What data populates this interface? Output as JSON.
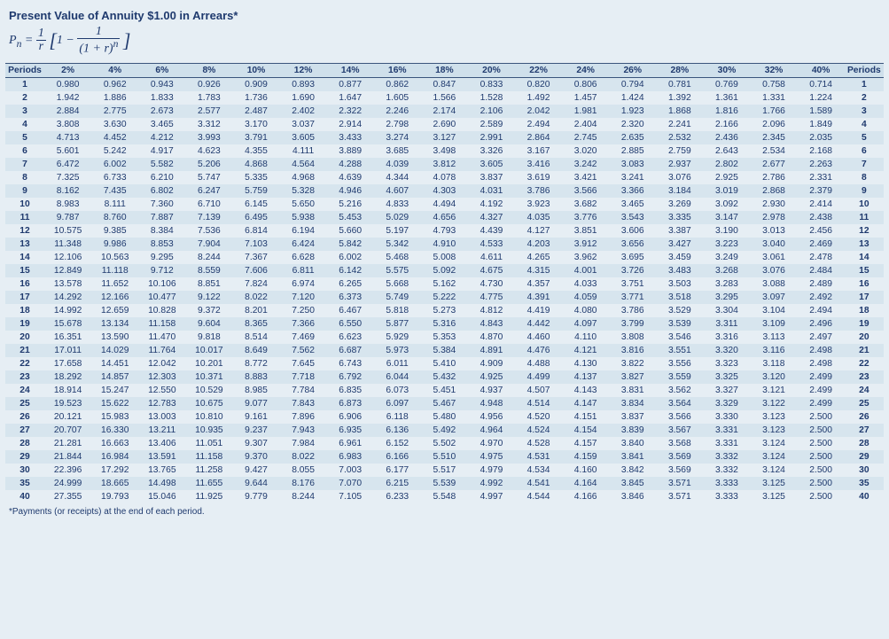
{
  "title": "Present Value of Annuity $1.00 in Arrears*",
  "formula_html": "<i>P<sub>n</sub></i> = <span style=\"font-size:18px;\">1</span>/<i>r</i> [1 − 1/(1 + <i>r</i>)<sup><i>n</i></sup>]",
  "footnote": "*Payments (or receipts) at the end of each period.",
  "header_periods": "Periods",
  "chart_data": {
    "type": "table",
    "rates": [
      "2%",
      "4%",
      "6%",
      "8%",
      "10%",
      "12%",
      "14%",
      "16%",
      "18%",
      "20%",
      "22%",
      "24%",
      "26%",
      "28%",
      "30%",
      "32%",
      "40%"
    ],
    "periods": [
      1,
      2,
      3,
      4,
      5,
      6,
      7,
      8,
      9,
      10,
      11,
      12,
      13,
      14,
      15,
      16,
      17,
      18,
      19,
      20,
      21,
      22,
      23,
      24,
      25,
      26,
      27,
      28,
      29,
      30,
      35,
      40
    ],
    "rows": [
      [
        0.98,
        0.962,
        0.943,
        0.926,
        0.909,
        0.893,
        0.877,
        0.862,
        0.847,
        0.833,
        0.82,
        0.806,
        0.794,
        0.781,
        0.769,
        0.758,
        0.714
      ],
      [
        1.942,
        1.886,
        1.833,
        1.783,
        1.736,
        1.69,
        1.647,
        1.605,
        1.566,
        1.528,
        1.492,
        1.457,
        1.424,
        1.392,
        1.361,
        1.331,
        1.224
      ],
      [
        2.884,
        2.775,
        2.673,
        2.577,
        2.487,
        2.402,
        2.322,
        2.246,
        2.174,
        2.106,
        2.042,
        1.981,
        1.923,
        1.868,
        1.816,
        1.766,
        1.589
      ],
      [
        3.808,
        3.63,
        3.465,
        3.312,
        3.17,
        3.037,
        2.914,
        2.798,
        2.69,
        2.589,
        2.494,
        2.404,
        2.32,
        2.241,
        2.166,
        2.096,
        1.849
      ],
      [
        4.713,
        4.452,
        4.212,
        3.993,
        3.791,
        3.605,
        3.433,
        3.274,
        3.127,
        2.991,
        2.864,
        2.745,
        2.635,
        2.532,
        2.436,
        2.345,
        2.035
      ],
      [
        5.601,
        5.242,
        4.917,
        4.623,
        4.355,
        4.111,
        3.889,
        3.685,
        3.498,
        3.326,
        3.167,
        3.02,
        2.885,
        2.759,
        2.643,
        2.534,
        2.168
      ],
      [
        6.472,
        6.002,
        5.582,
        5.206,
        4.868,
        4.564,
        4.288,
        4.039,
        3.812,
        3.605,
        3.416,
        3.242,
        3.083,
        2.937,
        2.802,
        2.677,
        2.263
      ],
      [
        7.325,
        6.733,
        6.21,
        5.747,
        5.335,
        4.968,
        4.639,
        4.344,
        4.078,
        3.837,
        3.619,
        3.421,
        3.241,
        3.076,
        2.925,
        2.786,
        2.331
      ],
      [
        8.162,
        7.435,
        6.802,
        6.247,
        5.759,
        5.328,
        4.946,
        4.607,
        4.303,
        4.031,
        3.786,
        3.566,
        3.366,
        3.184,
        3.019,
        2.868,
        2.379
      ],
      [
        8.983,
        8.111,
        7.36,
        6.71,
        6.145,
        5.65,
        5.216,
        4.833,
        4.494,
        4.192,
        3.923,
        3.682,
        3.465,
        3.269,
        3.092,
        2.93,
        2.414
      ],
      [
        9.787,
        8.76,
        7.887,
        7.139,
        6.495,
        5.938,
        5.453,
        5.029,
        4.656,
        4.327,
        4.035,
        3.776,
        3.543,
        3.335,
        3.147,
        2.978,
        2.438
      ],
      [
        10.575,
        9.385,
        8.384,
        7.536,
        6.814,
        6.194,
        5.66,
        5.197,
        4.793,
        4.439,
        4.127,
        3.851,
        3.606,
        3.387,
        3.19,
        3.013,
        2.456
      ],
      [
        11.348,
        9.986,
        8.853,
        7.904,
        7.103,
        6.424,
        5.842,
        5.342,
        4.91,
        4.533,
        4.203,
        3.912,
        3.656,
        3.427,
        3.223,
        3.04,
        2.469
      ],
      [
        12.106,
        10.563,
        9.295,
        8.244,
        7.367,
        6.628,
        6.002,
        5.468,
        5.008,
        4.611,
        4.265,
        3.962,
        3.695,
        3.459,
        3.249,
        3.061,
        2.478
      ],
      [
        12.849,
        11.118,
        9.712,
        8.559,
        7.606,
        6.811,
        6.142,
        5.575,
        5.092,
        4.675,
        4.315,
        4.001,
        3.726,
        3.483,
        3.268,
        3.076,
        2.484
      ],
      [
        13.578,
        11.652,
        10.106,
        8.851,
        7.824,
        6.974,
        6.265,
        5.668,
        5.162,
        4.73,
        4.357,
        4.033,
        3.751,
        3.503,
        3.283,
        3.088,
        2.489
      ],
      [
        14.292,
        12.166,
        10.477,
        9.122,
        8.022,
        7.12,
        6.373,
        5.749,
        5.222,
        4.775,
        4.391,
        4.059,
        3.771,
        3.518,
        3.295,
        3.097,
        2.492
      ],
      [
        14.992,
        12.659,
        10.828,
        9.372,
        8.201,
        7.25,
        6.467,
        5.818,
        5.273,
        4.812,
        4.419,
        4.08,
        3.786,
        3.529,
        3.304,
        3.104,
        2.494
      ],
      [
        15.678,
        13.134,
        11.158,
        9.604,
        8.365,
        7.366,
        6.55,
        5.877,
        5.316,
        4.843,
        4.442,
        4.097,
        3.799,
        3.539,
        3.311,
        3.109,
        2.496
      ],
      [
        16.351,
        13.59,
        11.47,
        9.818,
        8.514,
        7.469,
        6.623,
        5.929,
        5.353,
        4.87,
        4.46,
        4.11,
        3.808,
        3.546,
        3.316,
        3.113,
        2.497
      ],
      [
        17.011,
        14.029,
        11.764,
        10.017,
        8.649,
        7.562,
        6.687,
        5.973,
        5.384,
        4.891,
        4.476,
        4.121,
        3.816,
        3.551,
        3.32,
        3.116,
        2.498
      ],
      [
        17.658,
        14.451,
        12.042,
        10.201,
        8.772,
        7.645,
        6.743,
        6.011,
        5.41,
        4.909,
        4.488,
        4.13,
        3.822,
        3.556,
        3.323,
        3.118,
        2.498
      ],
      [
        18.292,
        14.857,
        12.303,
        10.371,
        8.883,
        7.718,
        6.792,
        6.044,
        5.432,
        4.925,
        4.499,
        4.137,
        3.827,
        3.559,
        3.325,
        3.12,
        2.499
      ],
      [
        18.914,
        15.247,
        12.55,
        10.529,
        8.985,
        7.784,
        6.835,
        6.073,
        5.451,
        4.937,
        4.507,
        4.143,
        3.831,
        3.562,
        3.327,
        3.121,
        2.499
      ],
      [
        19.523,
        15.622,
        12.783,
        10.675,
        9.077,
        7.843,
        6.873,
        6.097,
        5.467,
        4.948,
        4.514,
        4.147,
        3.834,
        3.564,
        3.329,
        3.122,
        2.499
      ],
      [
        20.121,
        15.983,
        13.003,
        10.81,
        9.161,
        7.896,
        6.906,
        6.118,
        5.48,
        4.956,
        4.52,
        4.151,
        3.837,
        3.566,
        3.33,
        3.123,
        2.5
      ],
      [
        20.707,
        16.33,
        13.211,
        10.935,
        9.237,
        7.943,
        6.935,
        6.136,
        5.492,
        4.964,
        4.524,
        4.154,
        3.839,
        3.567,
        3.331,
        3.123,
        2.5
      ],
      [
        21.281,
        16.663,
        13.406,
        11.051,
        9.307,
        7.984,
        6.961,
        6.152,
        5.502,
        4.97,
        4.528,
        4.157,
        3.84,
        3.568,
        3.331,
        3.124,
        2.5
      ],
      [
        21.844,
        16.984,
        13.591,
        11.158,
        9.37,
        8.022,
        6.983,
        6.166,
        5.51,
        4.975,
        4.531,
        4.159,
        3.841,
        3.569,
        3.332,
        3.124,
        2.5
      ],
      [
        22.396,
        17.292,
        13.765,
        11.258,
        9.427,
        8.055,
        7.003,
        6.177,
        5.517,
        4.979,
        4.534,
        4.16,
        3.842,
        3.569,
        3.332,
        3.124,
        2.5
      ],
      [
        24.999,
        18.665,
        14.498,
        11.655,
        9.644,
        8.176,
        7.07,
        6.215,
        5.539,
        4.992,
        4.541,
        4.164,
        3.845,
        3.571,
        3.333,
        3.125,
        2.5
      ],
      [
        27.355,
        19.793,
        15.046,
        11.925,
        9.779,
        8.244,
        7.105,
        6.233,
        5.548,
        4.997,
        4.544,
        4.166,
        3.846,
        3.571,
        3.333,
        3.125,
        2.5
      ]
    ]
  }
}
